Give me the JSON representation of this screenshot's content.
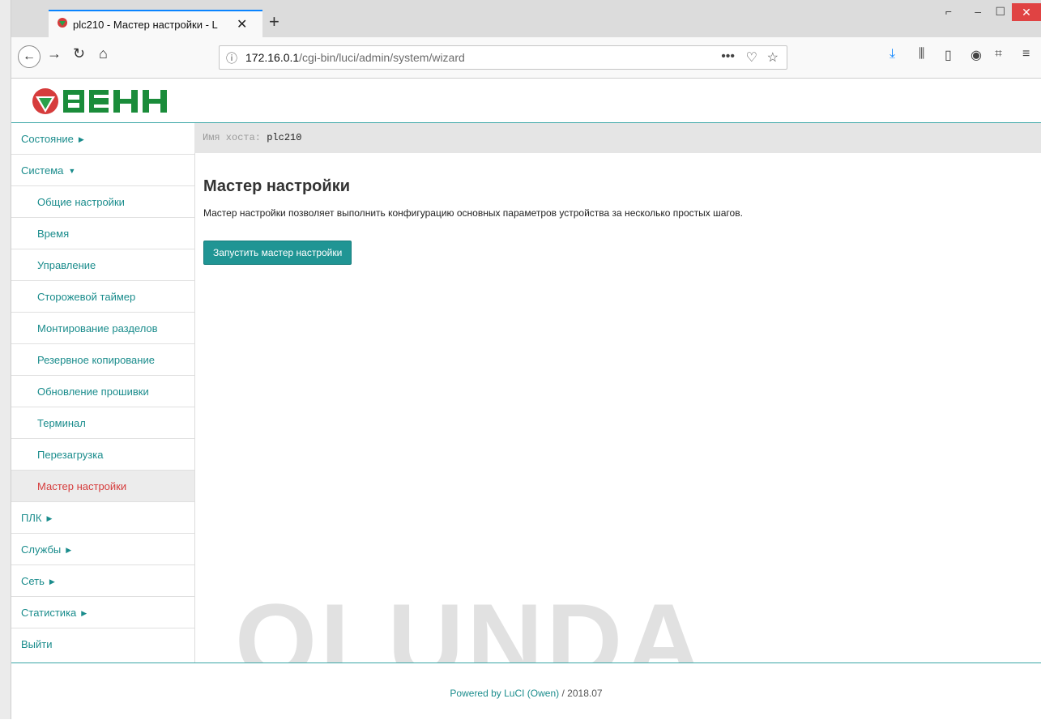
{
  "browser": {
    "tab_title": "plc210 - Мастер настройки - L",
    "tab_close": "✕",
    "new_tab": "+",
    "url_host": "172.16.0.1",
    "url_path": "/cgi-bin/luci/admin/system/wizard",
    "url_actions": "•••"
  },
  "logo_text": "ОВЕН",
  "hostbar": {
    "label": "Имя хоста:",
    "value": "plc210"
  },
  "menu": [
    {
      "label": "Состояние",
      "arrow": "▶"
    },
    {
      "label": "Система",
      "arrow": "▼"
    },
    {
      "label": "Общие настройки"
    },
    {
      "label": "Время"
    },
    {
      "label": "Управление"
    },
    {
      "label": "Сторожевой таймер"
    },
    {
      "label": "Монтирование разделов"
    },
    {
      "label": "Резервное копирование"
    },
    {
      "label": "Обновление прошивки"
    },
    {
      "label": "Терминал"
    },
    {
      "label": "Перезагрузка"
    },
    {
      "label": "Мастер настройки"
    },
    {
      "label": "ПЛК",
      "arrow": "▶"
    },
    {
      "label": "Службы",
      "arrow": "▶"
    },
    {
      "label": "Сеть",
      "arrow": "▶"
    },
    {
      "label": "Статистика",
      "arrow": "▶"
    },
    {
      "label": "Выйти"
    }
  ],
  "content": {
    "title": "Мастер настройки",
    "description": "Мастер настройки позволяет выполнить конфигурацию основных параметров устройства за несколько простых шагов.",
    "button": "Запустить мастер настройки"
  },
  "footer": {
    "powered": "Powered by LuCI (Owen)",
    "sep": " / ",
    "version": "2018.07"
  },
  "watermark": "OLUNDA",
  "colors": {
    "accent": "#209594",
    "active": "#d63c3c"
  }
}
